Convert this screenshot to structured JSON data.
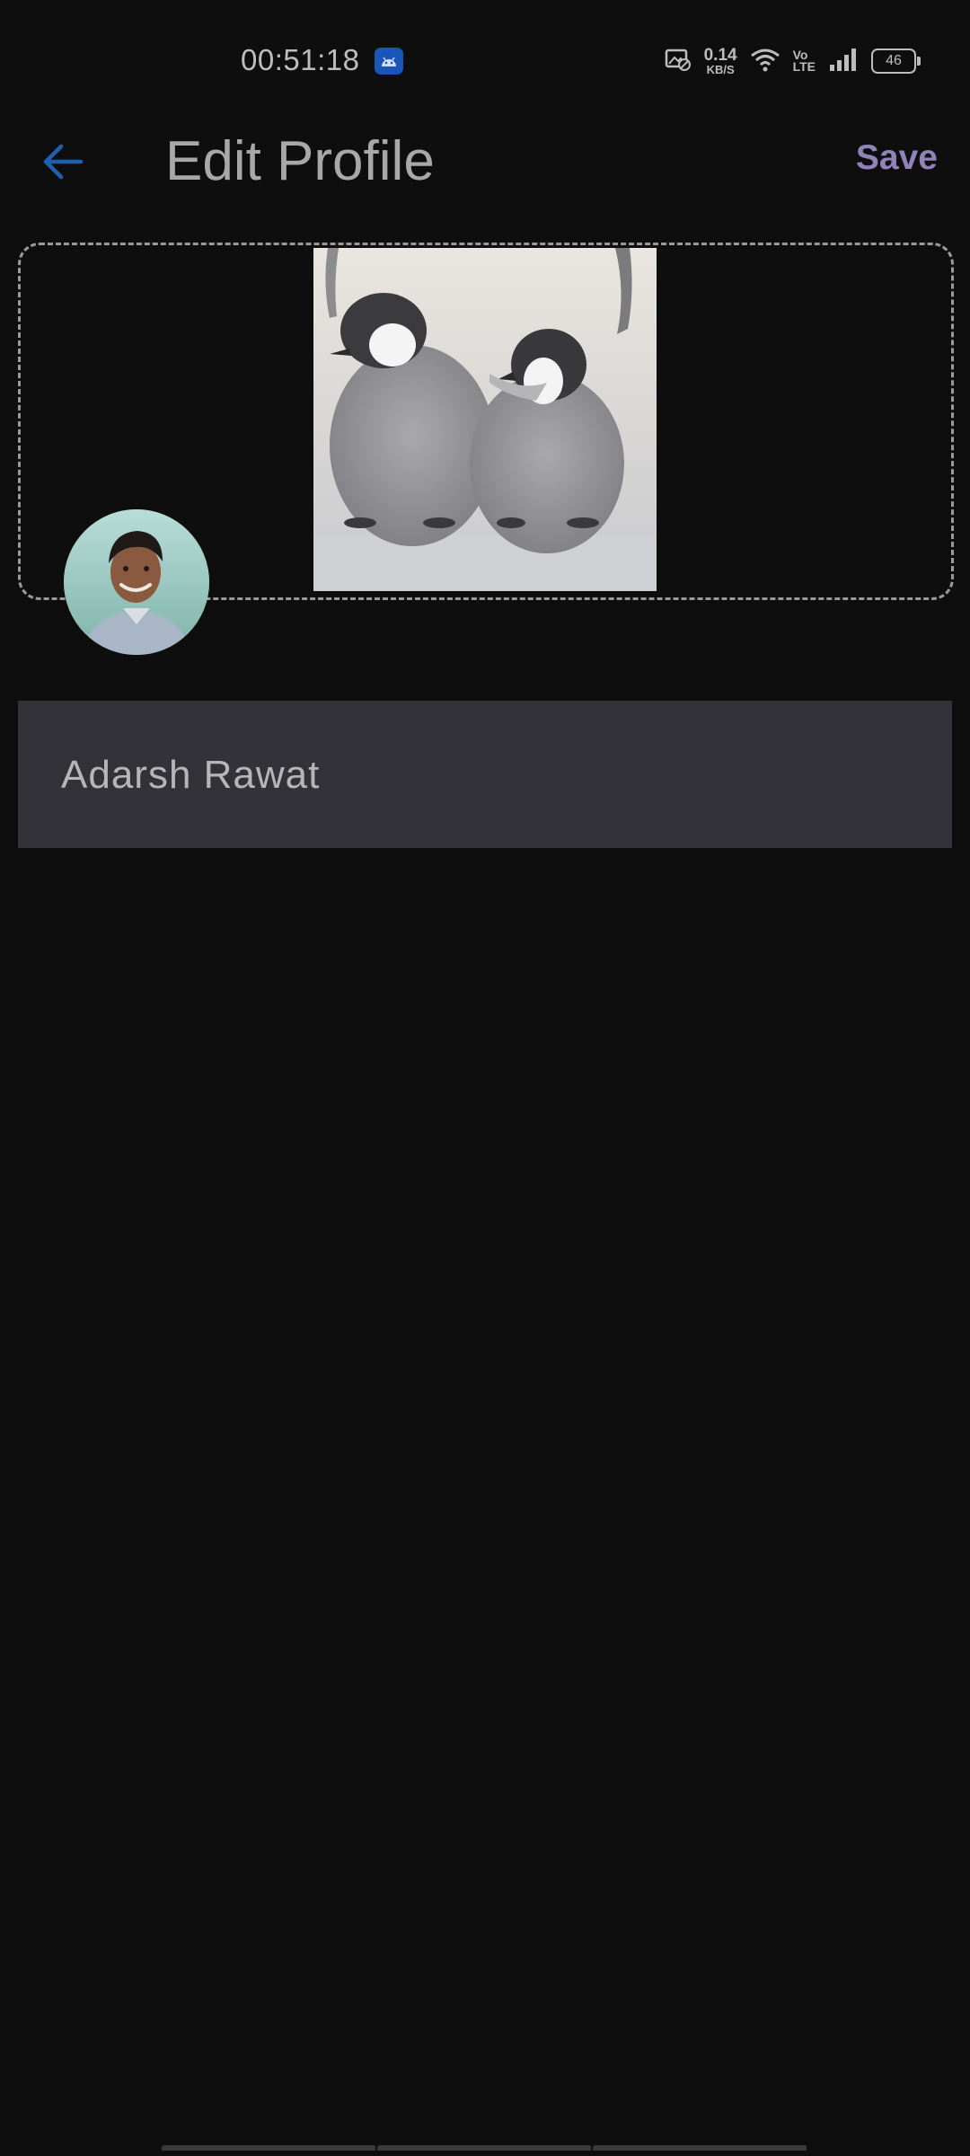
{
  "status_bar": {
    "time": "00:51:18",
    "net_speed_value": "0.14",
    "net_speed_unit": "KB/S",
    "volte_top": "Vo",
    "volte_bottom": "LTE",
    "battery_level": "46"
  },
  "app_bar": {
    "title": "Edit Profile",
    "save_label": "Save",
    "back_icon": "arrow-back-icon"
  },
  "cover": {
    "image_description": "penguin chicks photo"
  },
  "profile": {
    "name": "Adarsh Rawat"
  },
  "colors": {
    "background": "#0e0e0f",
    "accent_back": "#1f5fb0",
    "save": "#8f83b8",
    "field_bg": "#333238"
  }
}
